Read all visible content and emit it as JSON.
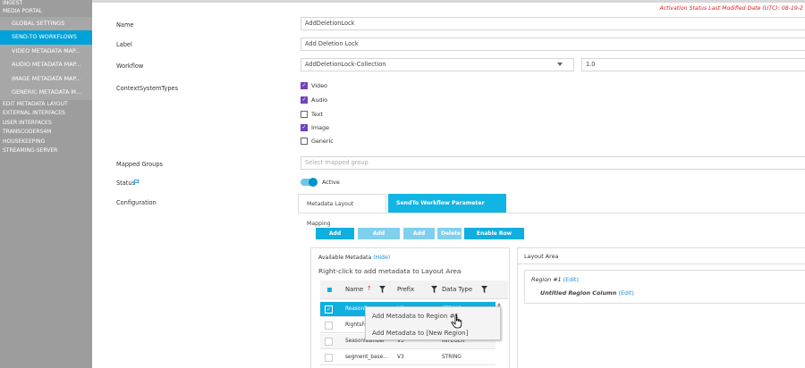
{
  "sidebar": {
    "items": [
      {
        "label": "INGEST",
        "sub": false,
        "active": false
      },
      {
        "label": "MEDIA PORTAL",
        "sub": false,
        "active": false
      },
      {
        "label": "GLOBAL SETTINGS",
        "sub": true,
        "active": false
      },
      {
        "label": "SEND-TO WORKFLOWS",
        "sub": true,
        "active": true
      },
      {
        "label": "VIDEO METADATA MAP...",
        "sub": true,
        "active": false
      },
      {
        "label": "AUDIO METADATA MAP...",
        "sub": true,
        "active": false
      },
      {
        "label": "IMAGE METADATA MAP...",
        "sub": true,
        "active": false
      },
      {
        "label": "GENERIC METADATA M...",
        "sub": true,
        "active": false
      },
      {
        "label": "EDIT METADATA LAYOUT",
        "sub": false,
        "active": false
      },
      {
        "label": "EXTERNAL INTERFACES",
        "sub": false,
        "active": false
      },
      {
        "label": "USER INTERFACES",
        "sub": false,
        "active": false
      },
      {
        "label": "TRANSCODERS4M",
        "sub": false,
        "active": false
      },
      {
        "label": "HOUSEKEEPING",
        "sub": false,
        "active": false
      },
      {
        "label": "STREAMING-SERVER",
        "sub": false,
        "active": false
      }
    ]
  },
  "header": {
    "activation": "Activation Status Last Modified Date (UTC): 08-19-2"
  },
  "form": {
    "name_label": "Name",
    "name_value": "AddDeletionLock",
    "label_label": "Label",
    "label_value": "Add Deletion Lock",
    "workflow_label": "Workflow",
    "workflow_value": "AddDeletionLock-Collection",
    "workflow_version": "1.0",
    "context_label": "ContextSystemTypes",
    "context_types": [
      {
        "label": "Video",
        "checked": true
      },
      {
        "label": "Audio",
        "checked": true
      },
      {
        "label": "Text",
        "checked": false
      },
      {
        "label": "Image",
        "checked": true
      },
      {
        "label": "Generic",
        "checked": false
      }
    ],
    "mapped_groups_label": "Mapped Groups",
    "mapped_groups_placeholder": "Select mapped group",
    "status_label": "Status",
    "status_value": "Active",
    "configuration_label": "Configuration"
  },
  "tabs": {
    "layout": "Metadata Layout Mapping",
    "param": "SendTo Workflow Parameter Mapping"
  },
  "actions": {
    "add_region": "Add Region",
    "add_column": "Add Column",
    "add_bag": "Add Bag",
    "delete": "Delete",
    "enable_sorting": "Enable Row Sorting"
  },
  "available": {
    "title": "Available Metadata",
    "hide": "(Hide)",
    "hint": "Right-click to add metadata to Layout Area",
    "columns": {
      "name": "Name",
      "prefix": "Prefix",
      "type": "Data Type"
    },
    "rows": [
      {
        "name": "ReasonFo...",
        "prefix": "V3",
        "type": "STRING",
        "selected": true
      },
      {
        "name": "RightsFr...",
        "prefix": "",
        "type": "G",
        "selected": false
      },
      {
        "name": "SeasonNumber",
        "prefix": "V3",
        "type": "INTEGER",
        "selected": false
      },
      {
        "name": "segment_base...",
        "prefix": "V3",
        "type": "STRING",
        "selected": false
      }
    ]
  },
  "context_menu": {
    "item1": "Add Metadata to Region #1",
    "item2": "Add Metadata to [New Region]"
  },
  "layout_area": {
    "title": "Layout Area",
    "region": "Region #1",
    "region_edit": "(Edit)",
    "column": "Untitled Region Column",
    "column_edit": "(Edit)"
  },
  "colors": {
    "accent": "#11aee0",
    "checkbox": "#6f42c1",
    "activation": "#e02020"
  }
}
